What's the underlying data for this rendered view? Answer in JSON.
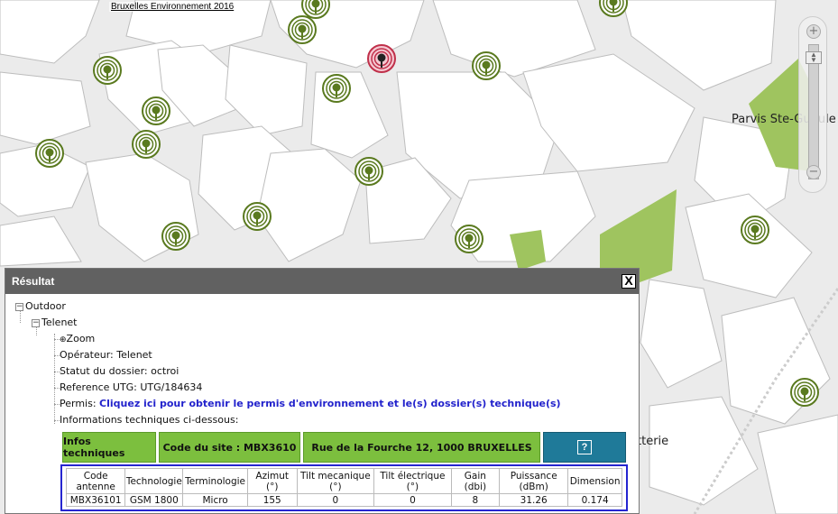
{
  "map": {
    "credit": "Bruxelles Environnement 2016",
    "place_labels": [
      "Parvis Ste-Gudule",
      "tterie"
    ],
    "colors": {
      "background": "#ebebeb",
      "block": "#ffffff",
      "park": "#9fc45f",
      "antenna": "#5a7a1f",
      "antenna_selected": "#c0304a"
    }
  },
  "zoom_control": {
    "plus": "+",
    "minus": "−"
  },
  "panel": {
    "title": "Résultat",
    "close": "X",
    "tree": {
      "root": "Outdoor",
      "operator_node": "Telenet",
      "zoom": "Zoom",
      "operateur": "Opérateur: Telenet",
      "statut": "Statut du dossier: octroi",
      "reference": "Reference UTG: UTG/184634",
      "permis_label": "Permis: ",
      "permis_link": "Cliquez ici pour obtenir le permis d'environnement et le(s) dossier(s) technique(s)",
      "infos_tech": "Informations techniques ci-dessous:"
    },
    "infobar": {
      "infos": "Infos techniques",
      "site_code": "Code du site : MBX3610",
      "address": "Rue de la Fourche 12, 1000 BRUXELLES",
      "help": "?"
    },
    "table": {
      "headers": [
        [
          "Code",
          "antenne"
        ],
        [
          "Technologie"
        ],
        [
          "Terminologie"
        ],
        [
          "Azimut",
          "(°)"
        ],
        [
          "Tilt mecanique",
          "(°)"
        ],
        [
          "Tilt électrique",
          "(°)"
        ],
        [
          "Gain",
          "(dbi)"
        ],
        [
          "Puissance",
          "(dBm)"
        ],
        [
          "Dimension"
        ]
      ],
      "rows": [
        [
          "MBX36101",
          "GSM 1800",
          "Micro",
          "155",
          "0",
          "0",
          "8",
          "31.26",
          "0.174"
        ]
      ]
    }
  }
}
